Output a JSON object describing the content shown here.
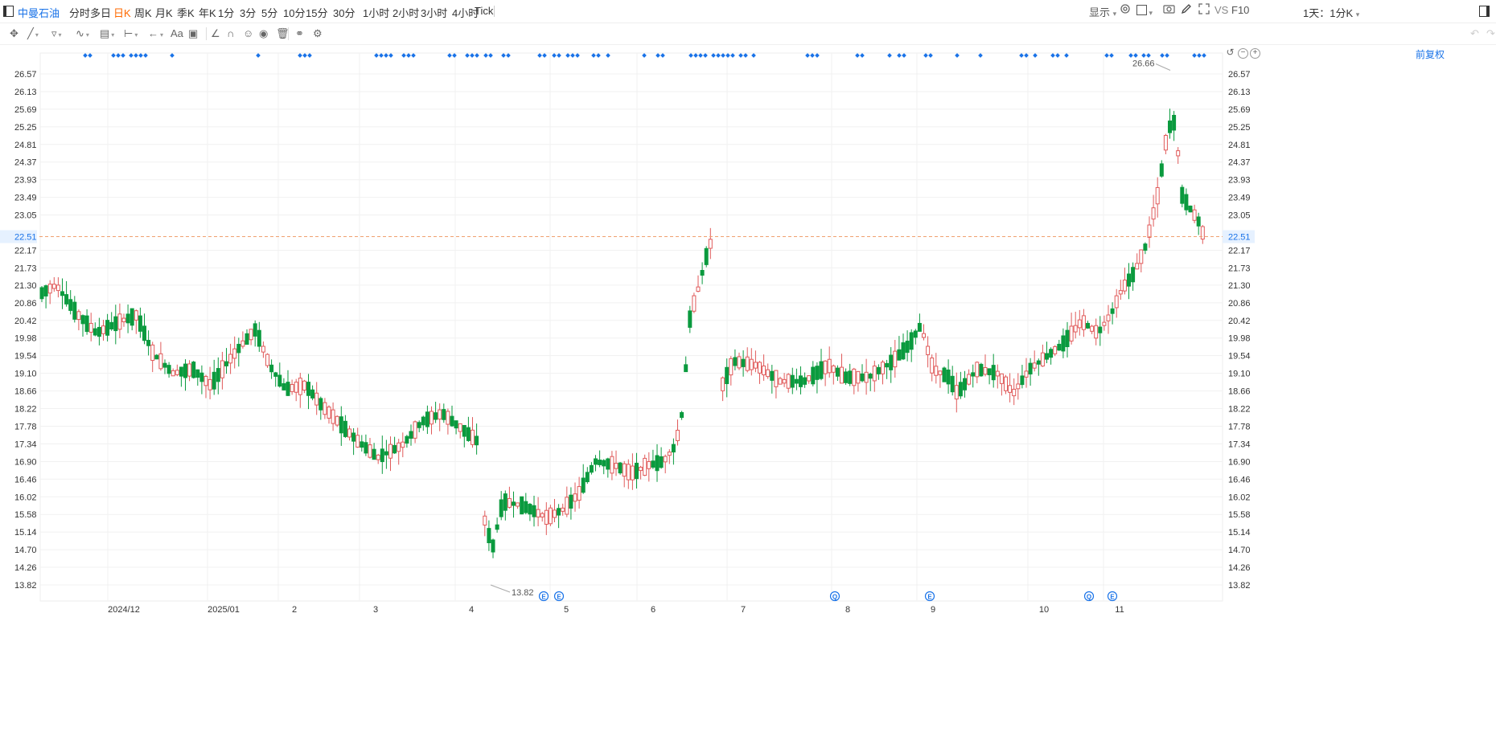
{
  "header": {
    "stock_name": "中曼石油",
    "periods": [
      "分时",
      "多日",
      "日K",
      "周K",
      "月K",
      "季K",
      "年K",
      "1分",
      "3分",
      "5分",
      "10分",
      "15分",
      "30分",
      "1小时",
      "2小时",
      "3小时",
      "4小时",
      "Tick"
    ],
    "active_period": "日K",
    "range_selector": "1天：1分K",
    "display_label": "显示",
    "vs_label": "VS",
    "f10_label": "F10"
  },
  "toolbar": {
    "text_tool_label": "Aa"
  },
  "chart_controls": {
    "adjust_label": "前复权"
  },
  "colors": {
    "up": "#e05a5a",
    "down": "#0a9a3e",
    "accent": "#1a73e8",
    "active_period": "#ff6a00",
    "last_price_line": "#f0a070",
    "last_price_tag": "#e6f1ff"
  },
  "chart_data": {
    "type": "candlestick",
    "y_ticks": [
      26.57,
      26.13,
      25.69,
      25.25,
      24.81,
      24.37,
      23.93,
      23.49,
      23.05,
      22.17,
      21.73,
      21.3,
      20.86,
      20.42,
      19.98,
      19.54,
      19.1,
      18.66,
      18.22,
      17.78,
      17.34,
      16.9,
      16.46,
      16.02,
      15.58,
      15.14,
      14.7,
      14.26,
      13.82
    ],
    "ylim": [
      13.62,
      27.0
    ],
    "x_labels": [
      "2024/12",
      "2025/01",
      "2",
      "3",
      "4",
      "5",
      "6",
      "7",
      "8",
      "9",
      "10",
      "11"
    ],
    "last_price": "22.51",
    "high_label": "26.66",
    "low_label": "13.82",
    "event_markers": [
      {
        "label": "E",
        "between": [
          "4",
          "5"
        ]
      },
      {
        "label": "E",
        "between": [
          "4",
          "5"
        ]
      },
      {
        "label": "Q",
        "between": [
          "7",
          "8"
        ]
      },
      {
        "label": "E",
        "between": [
          "8",
          "9"
        ]
      },
      {
        "label": "Q",
        "between": [
          "10",
          "11"
        ]
      },
      {
        "label": "E",
        "between": [
          "10",
          "11"
        ]
      }
    ],
    "segments": [
      {
        "x_start": "2024/11",
        "x_end": "2025/01",
        "from": 21.1,
        "to": 19.0,
        "trend": "down"
      },
      {
        "x_start": "2025/01",
        "x_end": "2025/03",
        "from": 19.0,
        "to": 17.0,
        "trend": "down"
      },
      {
        "x_start": "2025/03",
        "x_end": "2025/04",
        "from": 17.0,
        "to": 17.4,
        "trend": "flat"
      },
      {
        "x_start": "2025/04",
        "x_end": "2025/06",
        "from": 15.3,
        "to": 17.4,
        "trend": "up"
      },
      {
        "x_start": "2025/06",
        "x_end": "2025/07",
        "from": 17.4,
        "to": 22.6,
        "trend": "up"
      },
      {
        "x_start": "2025/07",
        "x_end": "2025/10",
        "from": 19.3,
        "to": 19.0,
        "trend": "flat"
      },
      {
        "x_start": "2025/10",
        "x_end": "2025/11",
        "from": 19.0,
        "to": 26.66,
        "trend": "up"
      },
      {
        "x_start": "2025/11",
        "x_end": "2025/11",
        "from": 26.66,
        "to": 22.51,
        "trend": "down"
      }
    ]
  }
}
